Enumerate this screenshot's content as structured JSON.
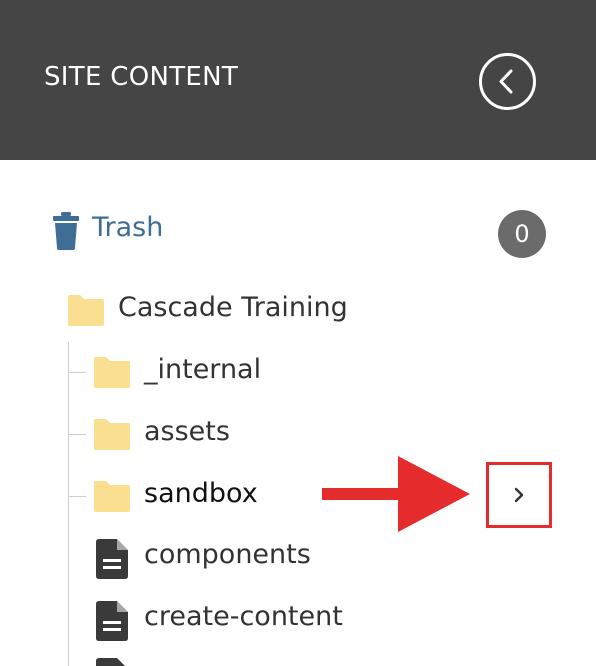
{
  "header": {
    "title": "SITE CONTENT",
    "collapse_icon": "chevron-left-circle-icon"
  },
  "trash": {
    "label": "Trash",
    "count": "0",
    "icon": "trash-icon"
  },
  "tree": {
    "root": {
      "label": "Cascade Training",
      "type": "folder"
    },
    "children": [
      {
        "label": "_internal",
        "type": "folder"
      },
      {
        "label": "assets",
        "type": "folder"
      },
      {
        "label": "sandbox",
        "type": "folder"
      },
      {
        "label": "components",
        "type": "page"
      },
      {
        "label": "create-content",
        "type": "page"
      }
    ]
  },
  "annotation": {
    "arrow_color": "#e52b2b",
    "highlighted_control": "expand-chevron-icon"
  },
  "colors": {
    "header_bg": "#454545",
    "link_blue": "#3f6d96",
    "folder_yellow": "#f9df8f",
    "badge_gray": "#6b6b6b",
    "annotation_red": "#e52b2b"
  }
}
